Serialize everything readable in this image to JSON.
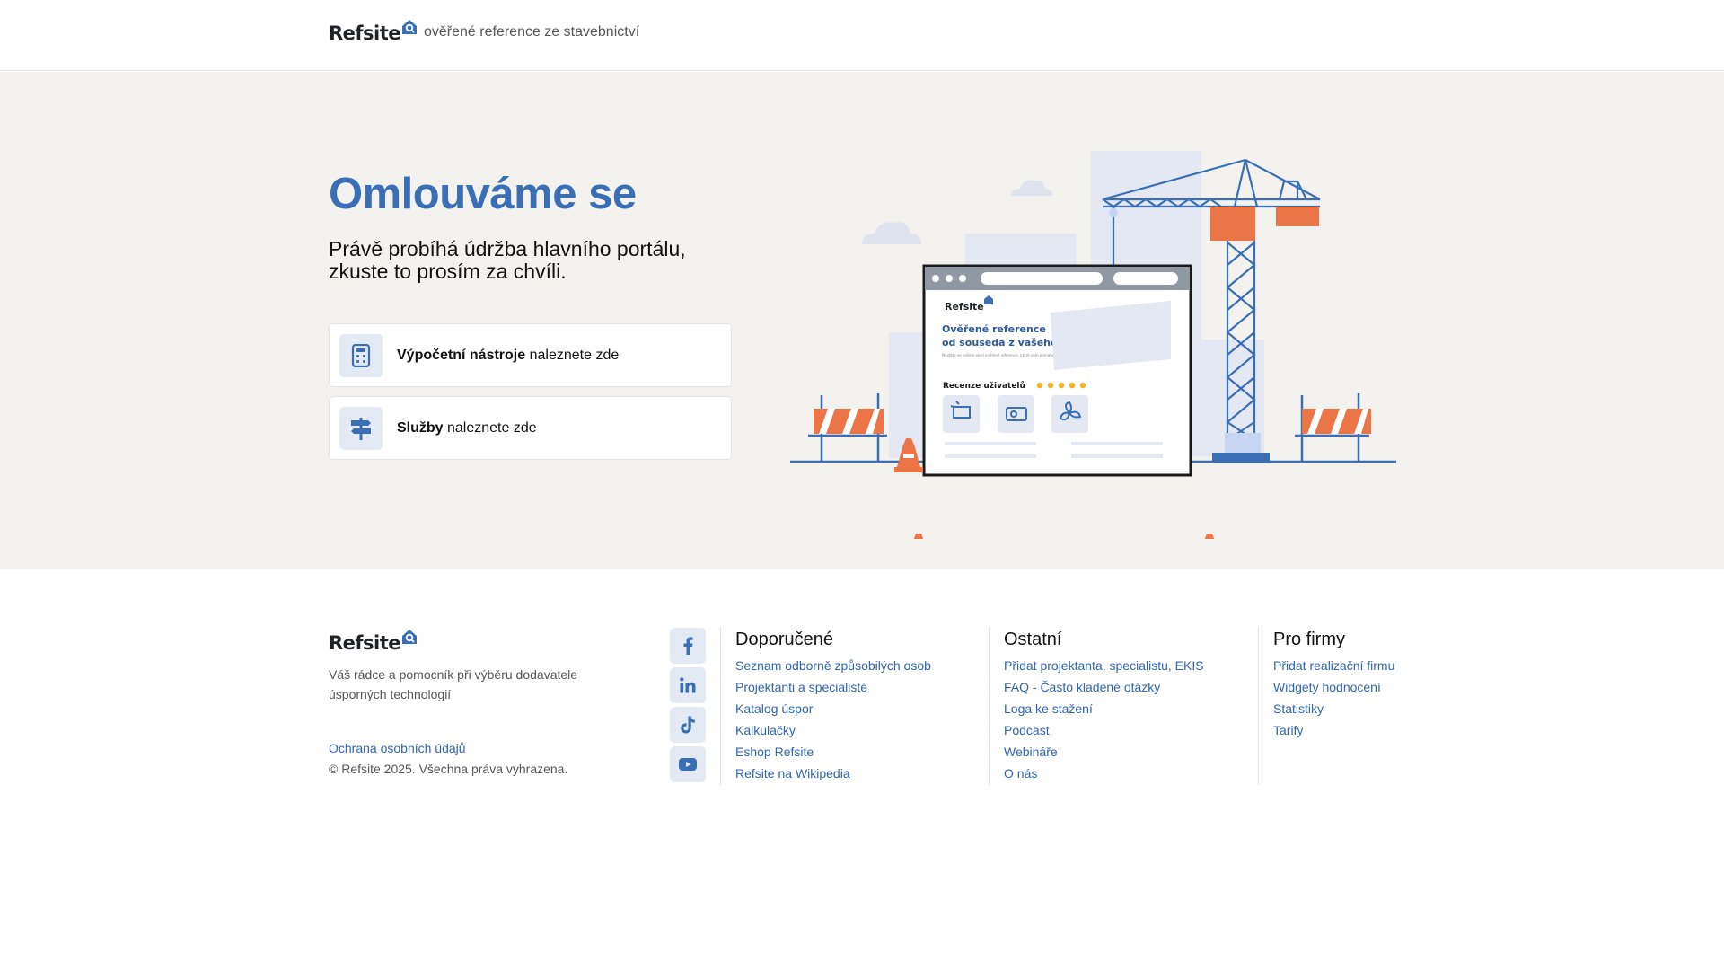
{
  "header": {
    "logo_text": "Refsite",
    "tagline": "ověřené reference ze stavebnictví"
  },
  "hero": {
    "title": "Omlouváme se",
    "subtitle_line1": "Právě probíhá údržba hlavního portálu,",
    "subtitle_line2": "zkuste to prosím za chvíli.",
    "cards": [
      {
        "bold": "Výpočetní nástroje",
        "rest": " naleznete zde",
        "icon": "calculator-icon"
      },
      {
        "bold": "Služby",
        "rest": " naleznete zde",
        "icon": "signpost-icon"
      }
    ],
    "illustration": {
      "logo_text": "Refsite",
      "heading_line1": "Ověřené reference",
      "heading_line2": "od souseda z vašeho o",
      "small_text": "Najděte ve vašem okolí ověřené reference, které vám pomohou",
      "reviews_label": "Recenze uživatelů"
    }
  },
  "footer": {
    "logo_text": "Refsite",
    "description_line1": "Váš rádce a pomocník při výběru dodavatele",
    "description_line2": "úsporných technologií",
    "privacy": "Ochrana osobních údajů",
    "copyright": "© Refsite 2025. Všechna práva vyhrazena.",
    "socials": [
      "facebook-icon",
      "linkedin-icon",
      "tiktok-icon",
      "youtube-icon"
    ],
    "columns": [
      {
        "title": "Doporučené",
        "links": [
          "Seznam odborně způsobilých osob",
          "Projektanti a specialisté",
          "Katalog úspor",
          "Kalkulačky",
          "Eshop Refsite",
          "Refsite na Wikipedia"
        ]
      },
      {
        "title": "Ostatní",
        "links": [
          "Přidat projektanta, specialistu, EKIS",
          "FAQ - Často kladené otázky",
          "Loga ke stažení",
          "Podcast",
          "Webináře",
          "O nás"
        ]
      },
      {
        "title": "Pro firmy",
        "links": [
          "Přidat realizační firmu",
          "Widgety hodnocení",
          "Statistiky",
          "Tarify"
        ]
      }
    ]
  },
  "colors": {
    "brand_blue": "#3a6fb5",
    "link_blue": "#2f66ad",
    "accent_orange": "#ec7547",
    "hero_bg": "#f3f2ef",
    "icon_tile_bg": "#e4eaf4"
  }
}
